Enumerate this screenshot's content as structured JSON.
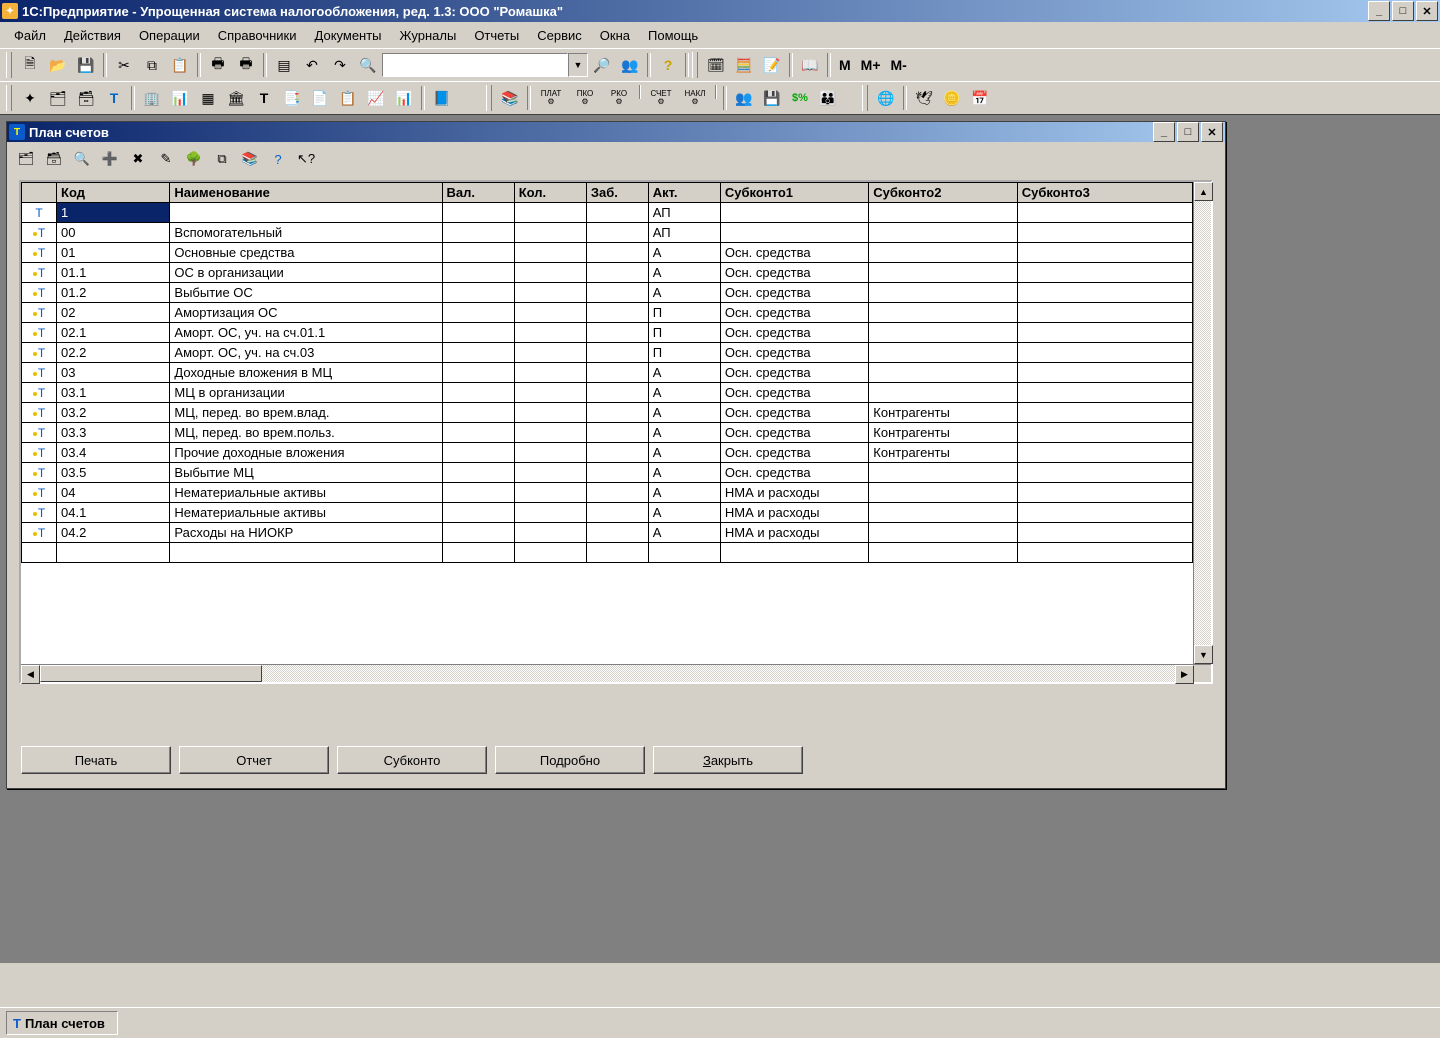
{
  "app": {
    "title": "1С:Предприятие - Упрощенная система налогообложения, ред. 1.3: ООО \"Ромашка\""
  },
  "menu": [
    "Файл",
    "Действия",
    "Операции",
    "Справочники",
    "Документы",
    "Журналы",
    "Отчеты",
    "Сервис",
    "Окна",
    "Помощь"
  ],
  "memory_buttons": [
    "M",
    "M+",
    "M-"
  ],
  "toolbar2_text_icons": [
    "ПЛАТ",
    "ПКО",
    "РКО",
    "СЧЕТ",
    "НАКЛ"
  ],
  "child": {
    "title": "План счетов",
    "columns": [
      "",
      "Код",
      "Наименование",
      "Вал.",
      "Кол.",
      "Заб.",
      "Акт.",
      "Субконто1",
      "Субконто2",
      "Субконто3"
    ],
    "rows": [
      {
        "icon": "t-blue",
        "code": "1",
        "name": "",
        "val": "",
        "kol": "",
        "zab": "",
        "akt": "АП",
        "s1": "",
        "s2": "",
        "s3": "",
        "sel": true
      },
      {
        "icon": "t-yel",
        "code": "00",
        "name": "Вспомогательный",
        "val": "",
        "kol": "",
        "zab": "",
        "akt": "АП",
        "s1": "",
        "s2": "",
        "s3": ""
      },
      {
        "icon": "t-yel",
        "code": "01",
        "name": "Основные средства",
        "val": "",
        "kol": "",
        "zab": "",
        "akt": "А",
        "s1": "Осн. средства",
        "s2": "",
        "s3": ""
      },
      {
        "icon": "t-yel",
        "code": "01.1",
        "name": "ОС в организации",
        "val": "",
        "kol": "",
        "zab": "",
        "akt": "А",
        "s1": "Осн. средства",
        "s2": "",
        "s3": ""
      },
      {
        "icon": "t-yel",
        "code": "01.2",
        "name": "Выбытие ОС",
        "val": "",
        "kol": "",
        "zab": "",
        "akt": "А",
        "s1": "Осн. средства",
        "s2": "",
        "s3": ""
      },
      {
        "icon": "t-yel",
        "code": "02",
        "name": "Амортизация ОС",
        "val": "",
        "kol": "",
        "zab": "",
        "akt": "П",
        "s1": "Осн. средства",
        "s2": "",
        "s3": ""
      },
      {
        "icon": "t-yel",
        "code": "02.1",
        "name": "Аморт. ОС, уч. на сч.01.1",
        "val": "",
        "kol": "",
        "zab": "",
        "akt": "П",
        "s1": "Осн. средства",
        "s2": "",
        "s3": ""
      },
      {
        "icon": "t-yel",
        "code": "02.2",
        "name": "Аморт. ОС, уч. на сч.03",
        "val": "",
        "kol": "",
        "zab": "",
        "akt": "П",
        "s1": "Осн. средства",
        "s2": "",
        "s3": ""
      },
      {
        "icon": "t-yel",
        "code": "03",
        "name": "Доходные вложения в МЦ",
        "val": "",
        "kol": "",
        "zab": "",
        "akt": "А",
        "s1": "Осн. средства",
        "s2": "",
        "s3": ""
      },
      {
        "icon": "t-yel",
        "code": "03.1",
        "name": "МЦ в организации",
        "val": "",
        "kol": "",
        "zab": "",
        "akt": "А",
        "s1": "Осн. средства",
        "s2": "",
        "s3": ""
      },
      {
        "icon": "t-yel",
        "code": "03.2",
        "name": "МЦ, перед. во врем.влад.",
        "val": "",
        "kol": "",
        "zab": "",
        "akt": "А",
        "s1": "Осн. средства",
        "s2": "Контрагенты",
        "s3": ""
      },
      {
        "icon": "t-yel",
        "code": "03.3",
        "name": "МЦ, перед. во врем.польз.",
        "val": "",
        "kol": "",
        "zab": "",
        "akt": "А",
        "s1": "Осн. средства",
        "s2": "Контрагенты",
        "s3": ""
      },
      {
        "icon": "t-yel",
        "code": "03.4",
        "name": "Прочие доходные вложения",
        "val": "",
        "kol": "",
        "zab": "",
        "akt": "А",
        "s1": "Осн. средства",
        "s2": "Контрагенты",
        "s3": ""
      },
      {
        "icon": "t-yel",
        "code": "03.5",
        "name": "Выбытие МЦ",
        "val": "",
        "kol": "",
        "zab": "",
        "akt": "А",
        "s1": "Осн. средства",
        "s2": "",
        "s3": ""
      },
      {
        "icon": "t-yel",
        "code": "04",
        "name": "Нематериальные активы",
        "val": "",
        "kol": "",
        "zab": "",
        "akt": "А",
        "s1": "НМА и расходы",
        "s2": "",
        "s3": ""
      },
      {
        "icon": "t-yel",
        "code": "04.1",
        "name": "Нематериальные активы",
        "val": "",
        "kol": "",
        "zab": "",
        "akt": "А",
        "s1": "НМА и расходы",
        "s2": "",
        "s3": ""
      },
      {
        "icon": "t-yel",
        "code": "04.2",
        "name": "Расходы на НИОКР",
        "val": "",
        "kol": "",
        "zab": "",
        "akt": "А",
        "s1": "НМА и расходы",
        "s2": "",
        "s3": ""
      }
    ],
    "buttons": {
      "print": "Печать",
      "report": "Отчет",
      "subkonto": "Субконто",
      "detail": "Подробно",
      "close": "Закрыть",
      "close_ak": "З"
    }
  },
  "taskbar": {
    "item": "План счетов"
  }
}
